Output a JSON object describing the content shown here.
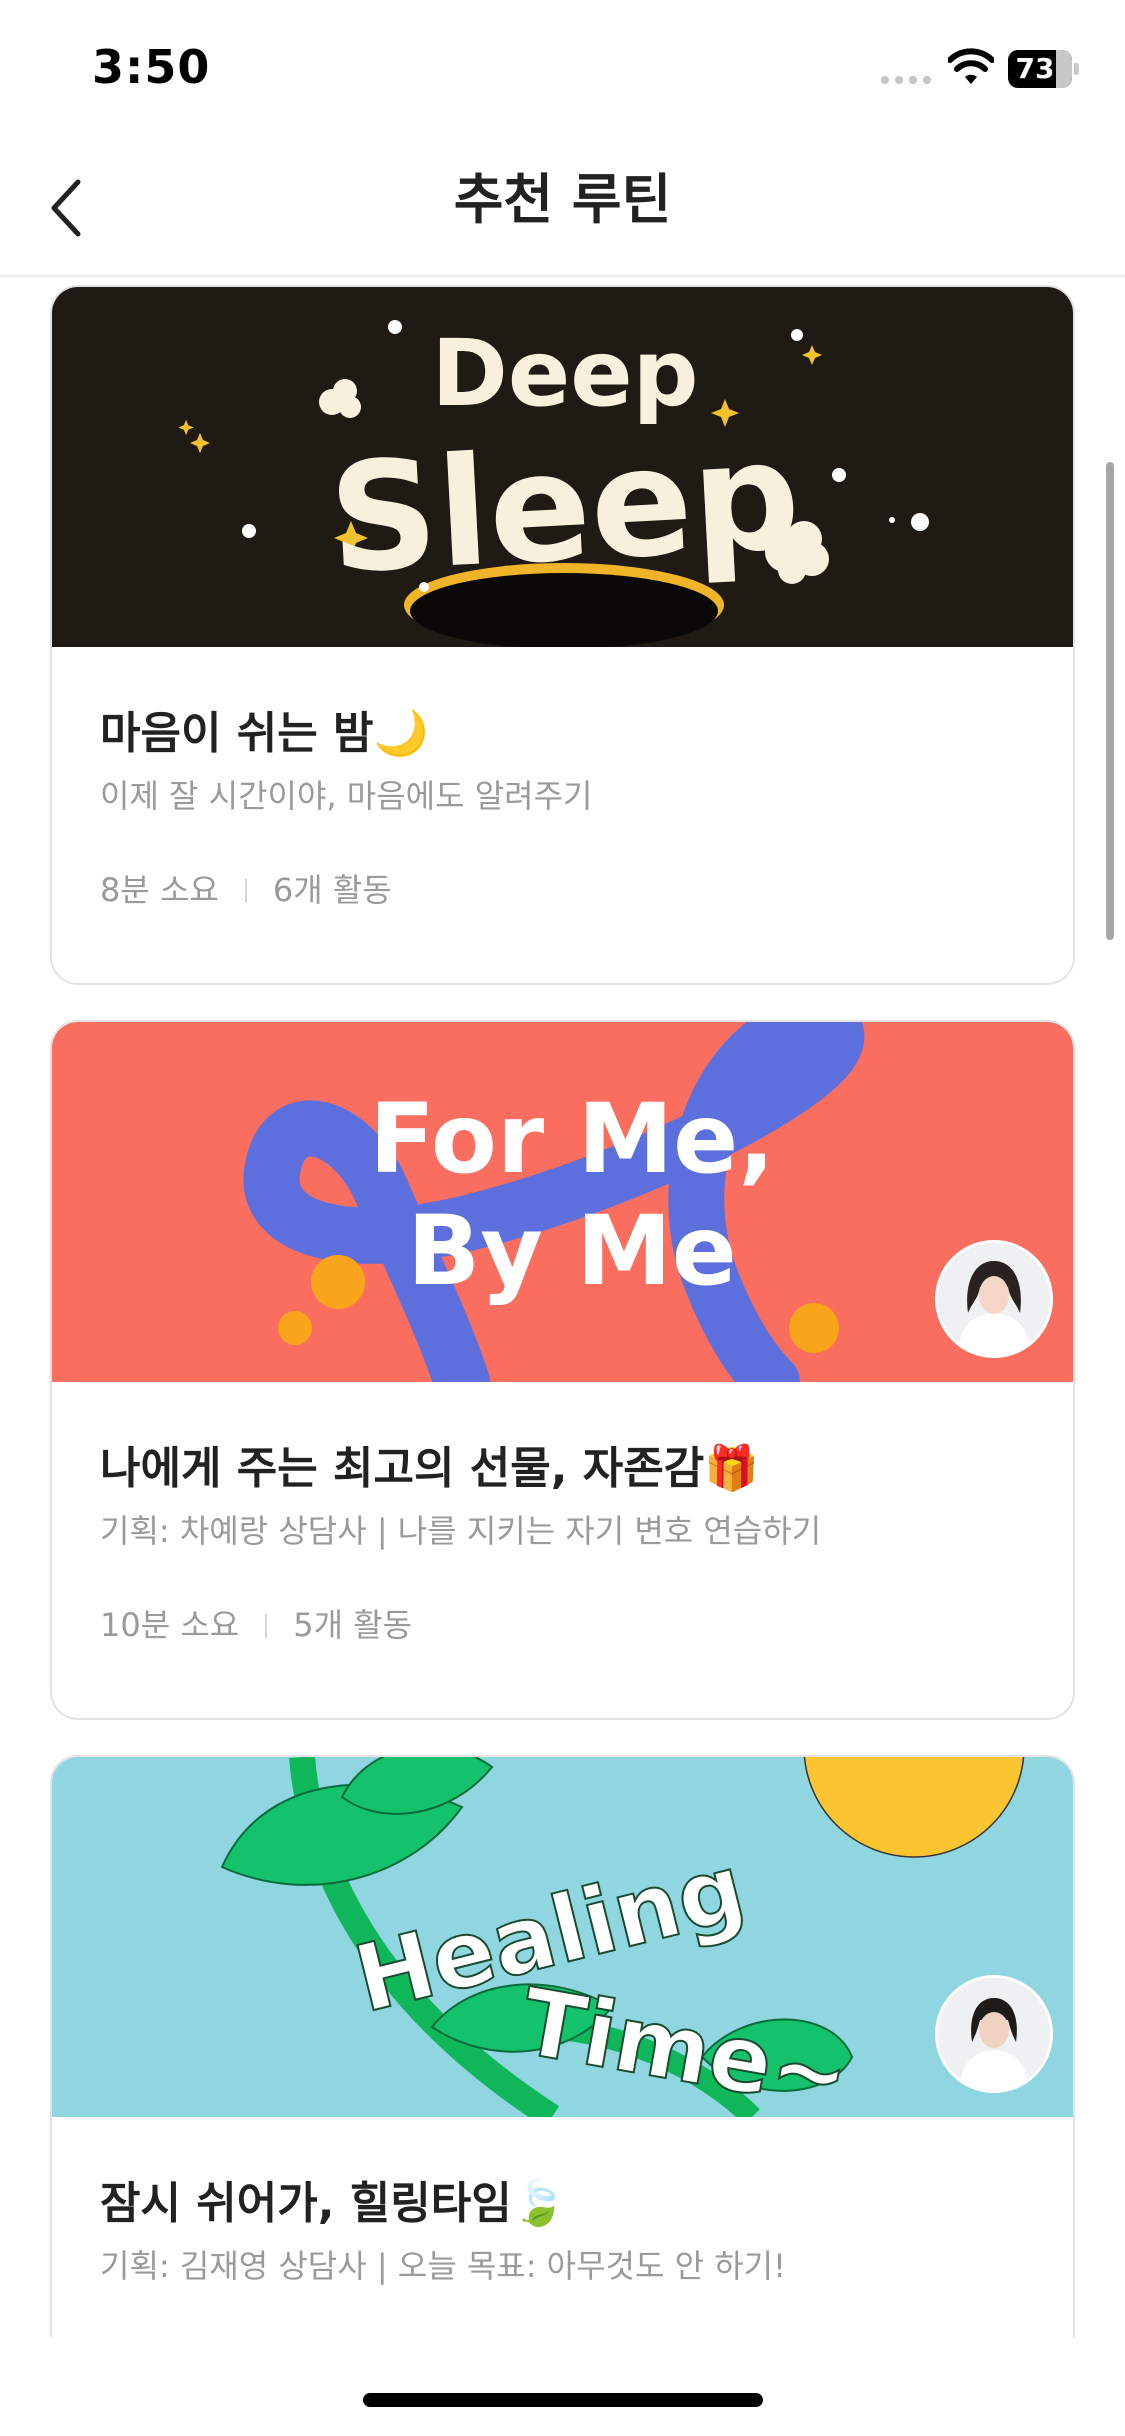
{
  "status_bar": {
    "time": "3:50",
    "battery": "73"
  },
  "header": {
    "title": "추천 루틴",
    "back_icon": "chevron-left-icon"
  },
  "routines": [
    {
      "banner_text": "Deep Sleep",
      "banner_bg": "#1f1a14",
      "title": "마음이 쉬는 밤🌙",
      "subtitle": "이제 잘 시간이야, 마음에도 알려주기",
      "duration": "8분 소요",
      "activities": "6개 활동"
    },
    {
      "banner_text": "For Me, By Me",
      "banner_bg": "#fa6e5f",
      "title": "나에게 주는 최고의 선물, 자존감🎁",
      "subtitle": "기획: 차예랑 상담사 | 나를 지키는 자기 변호 연습하기",
      "duration": "10분 소요",
      "activities": "5개 활동"
    },
    {
      "banner_text": "Healing Time~",
      "banner_bg": "#8fd6e0",
      "title": "잠시 쉬어가, 힐링타임🍃",
      "subtitle": "기획: 김재영 상담사 | 오늘 목표: 아무것도 안 하기!"
    }
  ]
}
